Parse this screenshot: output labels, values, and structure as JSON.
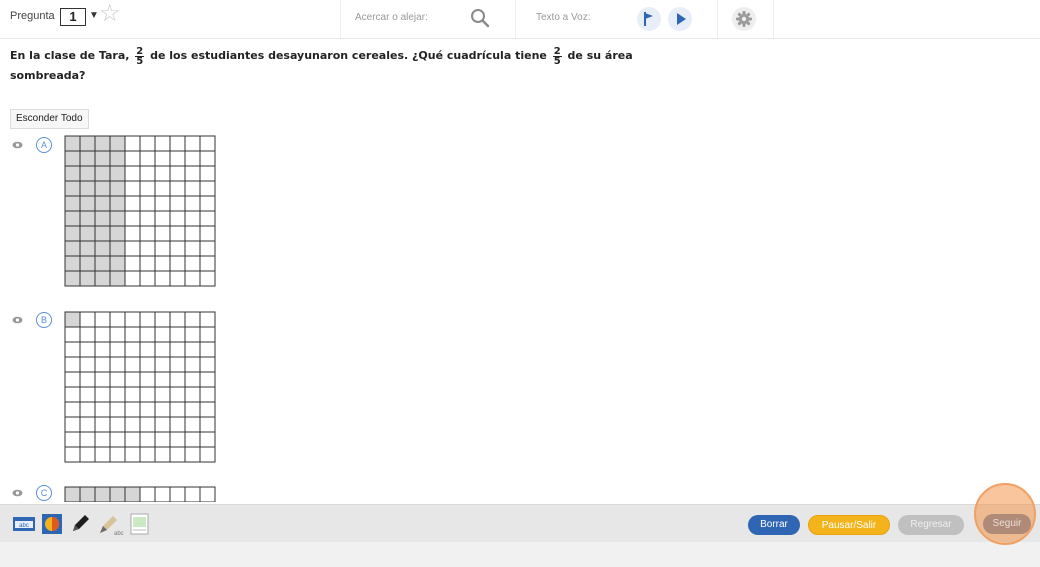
{
  "toolbar": {
    "question_label": "Pregunta",
    "question_number": "1",
    "caret": "▼",
    "star": "☆",
    "zoom_label": "Acercar o alejar:",
    "tts_label": "Texto a Voz:",
    "icons": [
      "star-icon",
      "zoom-icon",
      "tts-stop-icon",
      "tts-play-icon",
      "gear-icon"
    ]
  },
  "question": {
    "part1": "En la clase de Tara,",
    "part2": "de los estudiantes desayunaron cereales. ¿Qué cuadrícula tiene",
    "part3": "de su área",
    "part4": "sombreada?",
    "fraction_num": "2",
    "fraction_den": "5"
  },
  "hide_all_label": "Esconder Todo",
  "options": [
    {
      "letter": "A",
      "rows": 10,
      "cols": 10,
      "shaded_cols": 4,
      "shaded_count": 40
    },
    {
      "letter": "B",
      "rows": 10,
      "cols": 10,
      "shaded_count": 1
    },
    {
      "letter": "C",
      "rows": 1,
      "cols": 10,
      "shaded_count": 5
    }
  ],
  "bottom_tools": [
    "abc-line-reader-icon",
    "contrast-icon",
    "pen-icon",
    "highlighter-icon",
    "notepad-icon"
  ],
  "buttons": {
    "borrar": "Borrar",
    "pausar": "Pausar/Salir",
    "regresar": "Regresar",
    "seguir": "Seguir"
  },
  "colors": {
    "shade": "#d6d6d6",
    "option_blue": "#5a8fd6",
    "borrar": "#2f66b4",
    "pausar": "#f3b31b",
    "highlight": "#f4964a"
  }
}
